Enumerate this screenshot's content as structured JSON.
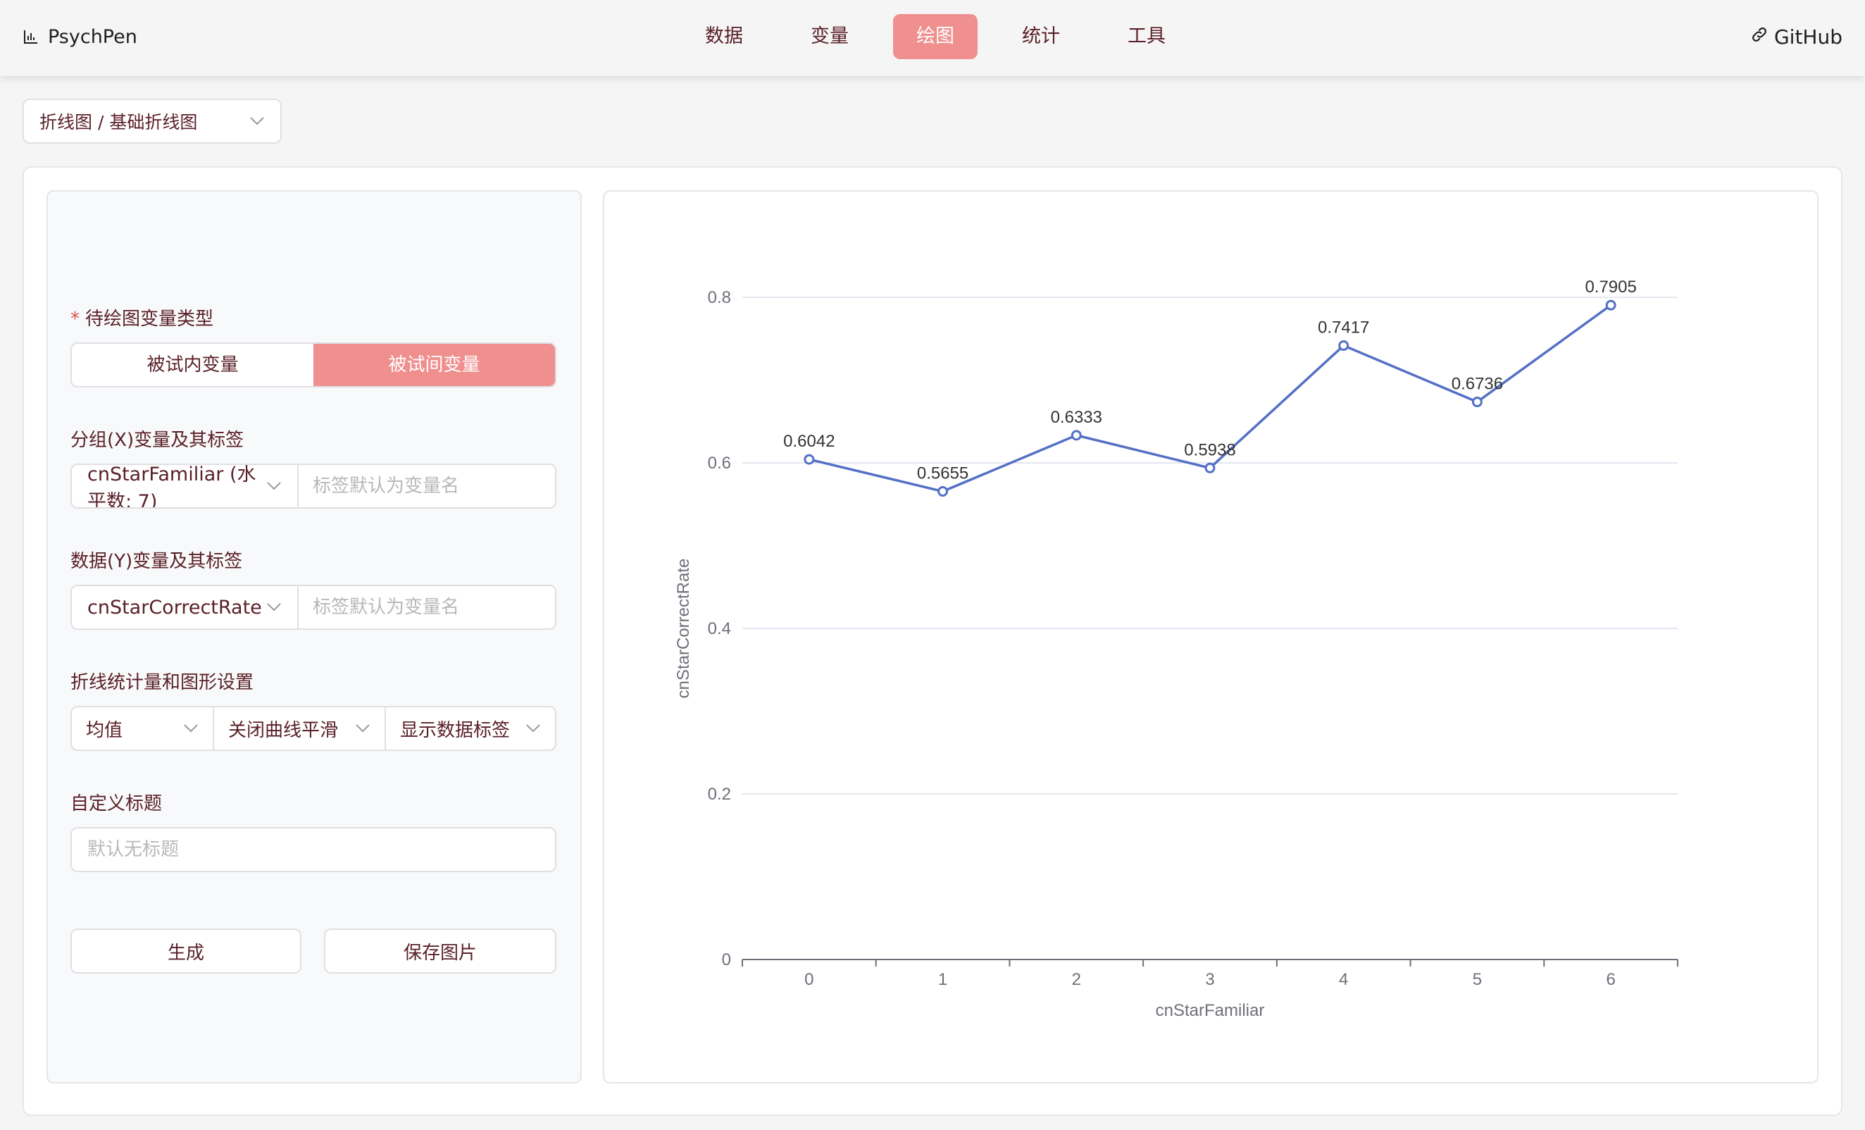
{
  "app": {
    "name": "PsychPen"
  },
  "nav": {
    "items": [
      {
        "label": "数据",
        "active": false
      },
      {
        "label": "变量",
        "active": false
      },
      {
        "label": "绘图",
        "active": true
      },
      {
        "label": "统计",
        "active": false
      },
      {
        "label": "工具",
        "active": false
      }
    ],
    "github": "GitHub"
  },
  "chart_type_select": {
    "value": "折线图 / 基础折线图"
  },
  "config": {
    "var_type": {
      "label": "待绘图变量类型",
      "required_mark": "*",
      "options": [
        "被试内变量",
        "被试间变量"
      ],
      "selected": "被试间变量"
    },
    "x_var": {
      "label": "分组(X)变量及其标签",
      "value": "cnStarFamiliar (水平数: 7)",
      "placeholder": "标签默认为变量名"
    },
    "y_var": {
      "label": "数据(Y)变量及其标签",
      "value": "cnStarCorrectRate",
      "placeholder": "标签默认为变量名"
    },
    "settings": {
      "label": "折线统计量和图形设置",
      "statistic": "均值",
      "smooth": "关闭曲线平滑",
      "data_labels": "显示数据标签"
    },
    "custom_title": {
      "label": "自定义标题",
      "placeholder": "默认无标题"
    },
    "buttons": {
      "generate": "生成",
      "save": "保存图片"
    }
  },
  "colors": {
    "accent": "#ef8f8e",
    "line": "#5470c6",
    "text": "#5a1f28"
  },
  "chart_data": {
    "type": "line",
    "title": "",
    "xlabel": "cnStarFamiliar",
    "ylabel": "cnStarCorrectRate",
    "categories": [
      "0",
      "1",
      "2",
      "3",
      "4",
      "5",
      "6"
    ],
    "values": [
      0.6042,
      0.5655,
      0.6333,
      0.5938,
      0.7417,
      0.6736,
      0.7905
    ],
    "data_labels": [
      "0.6042",
      "0.5655",
      "0.6333",
      "0.5938",
      "0.7417",
      "0.6736",
      "0.7905"
    ],
    "ylim": [
      0,
      0.8
    ],
    "yticks": [
      "0",
      "0.2",
      "0.4",
      "0.6",
      "0.8"
    ],
    "grid": true,
    "smooth": false
  }
}
